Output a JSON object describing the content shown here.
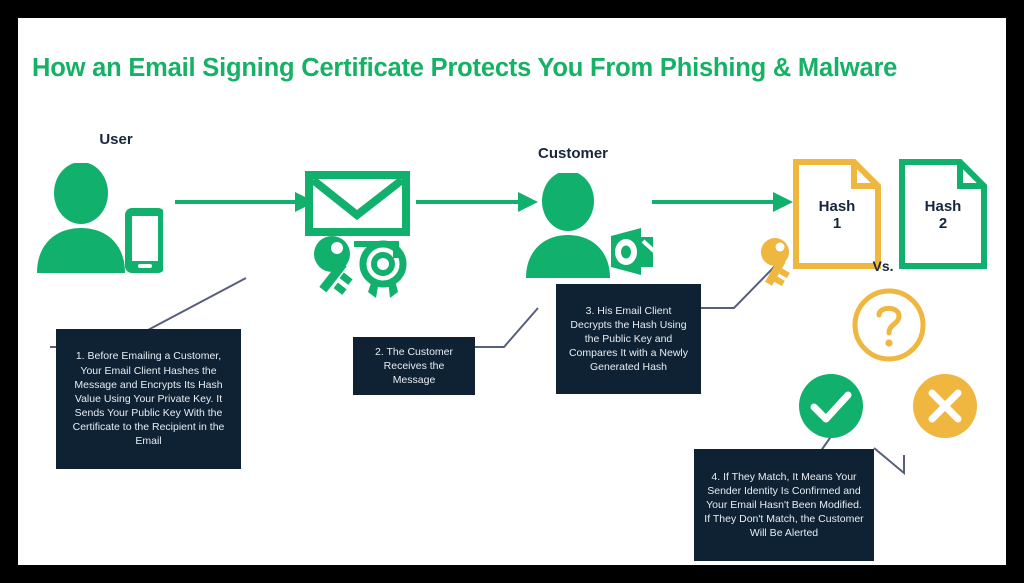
{
  "page": {
    "title": "How an Email Signing Certificate Protects You From Phishing & Malware",
    "frame_border_color": "#000000",
    "canvas_color": "#ffffff"
  },
  "colors": {
    "brand_green": "#11B06C",
    "title_green": "#15B265",
    "amber": "#EFB640",
    "dark_navy": "#0E2233",
    "connector": "#56607A",
    "text_light": "#E8EDF2"
  },
  "nodes": [
    {
      "id": "user",
      "label": "User",
      "icon": "user-with-phone-icon"
    },
    {
      "id": "email",
      "label": "",
      "icon": "envelope-icon"
    },
    {
      "id": "signature",
      "label": "",
      "icon": "key-and-certificate-seal-icon"
    },
    {
      "id": "customer",
      "label": "Customer",
      "icon": "customer-with-mail-client-icon"
    },
    {
      "id": "public-key",
      "label": "",
      "icon": "key-icon"
    }
  ],
  "hashes": [
    {
      "id": "hash-1",
      "label": "Hash\n1",
      "border_color": "#EFB640"
    },
    {
      "id": "hash-2",
      "label": "Hash\n2",
      "border_color": "#11B06C"
    }
  ],
  "comparison": {
    "vs_label": "Vs.",
    "question_icon": "question-mark-circle-icon",
    "match_icon": "checkmark-circle-icon",
    "mismatch_icon": "cross-circle-icon"
  },
  "steps": [
    {
      "id": "step-1",
      "text": "1. Before Emailing a Customer, Your Email Client Hashes the Message and Encrypts Its Hash Value Using Your Private Key. It Sends Your Public Key With the Certificate to the Recipient in the Email"
    },
    {
      "id": "step-2",
      "text": "2. The Customer Receives the Message"
    },
    {
      "id": "step-3",
      "text": "3. His Email Client Decrypts the Hash Using the Public Key and Compares It with a Newly Generated Hash"
    },
    {
      "id": "step-4",
      "text": "4. If They Match, It Means Your Sender Identity Is Confirmed and Your Email Hasn't Been Modified. If They Don't Match, the Customer Will Be Alerted"
    }
  ],
  "arrows": [
    {
      "id": "arrow-user-to-email"
    },
    {
      "id": "arrow-email-to-customer"
    },
    {
      "id": "arrow-customer-to-hash"
    }
  ]
}
